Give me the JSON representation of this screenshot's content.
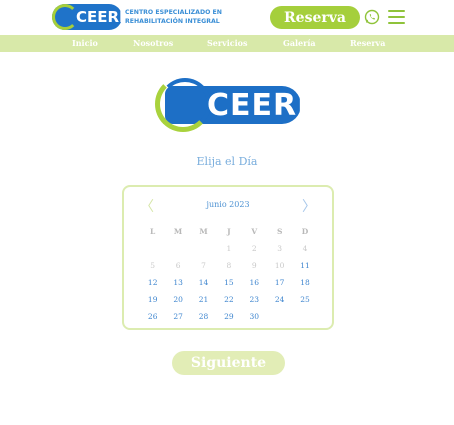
{
  "header": {
    "logo_text": "CEERI",
    "logo_sub_line1": "CENTRO ESPECIALIZADO EN",
    "logo_sub_line2": "REHABILITACIÓN INTEGRAL",
    "reserve_label": "Reserva",
    "whatsapp_icon": "whatsapp-icon",
    "menu_icon": "hamburger-menu-icon"
  },
  "nav": {
    "items": [
      "Inicio",
      "Nosotros",
      "Servicios",
      "Galería",
      "Reserva"
    ]
  },
  "main": {
    "logo_text": "CEERI",
    "prompt": "Elija el Día"
  },
  "calendar": {
    "prev_label": "〈",
    "next_label": "〉",
    "month_label": "junio 2023",
    "weekdays": [
      "L",
      "M",
      "M",
      "J",
      "V",
      "S",
      "D"
    ],
    "weeks": [
      [
        "",
        "",
        "",
        "1",
        "2",
        "3",
        "4"
      ],
      [
        "5",
        "6",
        "7",
        "8",
        "9",
        "10",
        "11"
      ],
      [
        "12",
        "13",
        "14",
        "15",
        "16",
        "17",
        "18"
      ],
      [
        "19",
        "20",
        "21",
        "22",
        "23",
        "24",
        "25"
      ],
      [
        "26",
        "27",
        "28",
        "29",
        "30",
        "",
        ""
      ]
    ],
    "first_available_day": 11
  },
  "footer": {
    "next_label": "Siguiente"
  },
  "colors": {
    "brand_blue": "#1d6fc6",
    "brand_green": "#a5cf3c",
    "nav_bg": "#d8e9a9",
    "disabled_button": "#e2edb6"
  }
}
